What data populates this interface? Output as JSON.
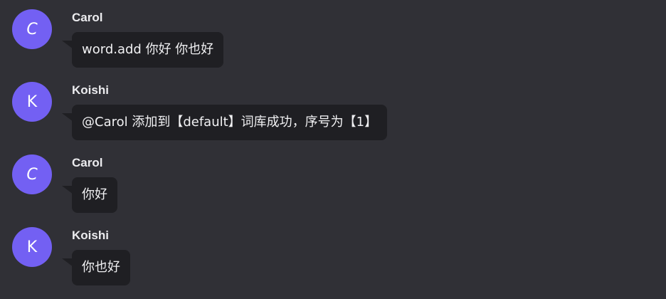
{
  "messages": [
    {
      "avatar_initial": "C",
      "sender": "Carol",
      "text": "word.add 你好 你也好"
    },
    {
      "avatar_initial": "K",
      "sender": "Koishi",
      "text": "@Carol 添加到【default】词库成功，序号为【1】"
    },
    {
      "avatar_initial": "C",
      "sender": "Carol",
      "text": "你好"
    },
    {
      "avatar_initial": "K",
      "sender": "Koishi",
      "text": "你也好"
    }
  ],
  "colors": {
    "background": "#303036",
    "avatar": "#7360f3",
    "bubble": "#1f1f23",
    "name_text": "#ececef",
    "message_text": "#f1f1f3"
  }
}
